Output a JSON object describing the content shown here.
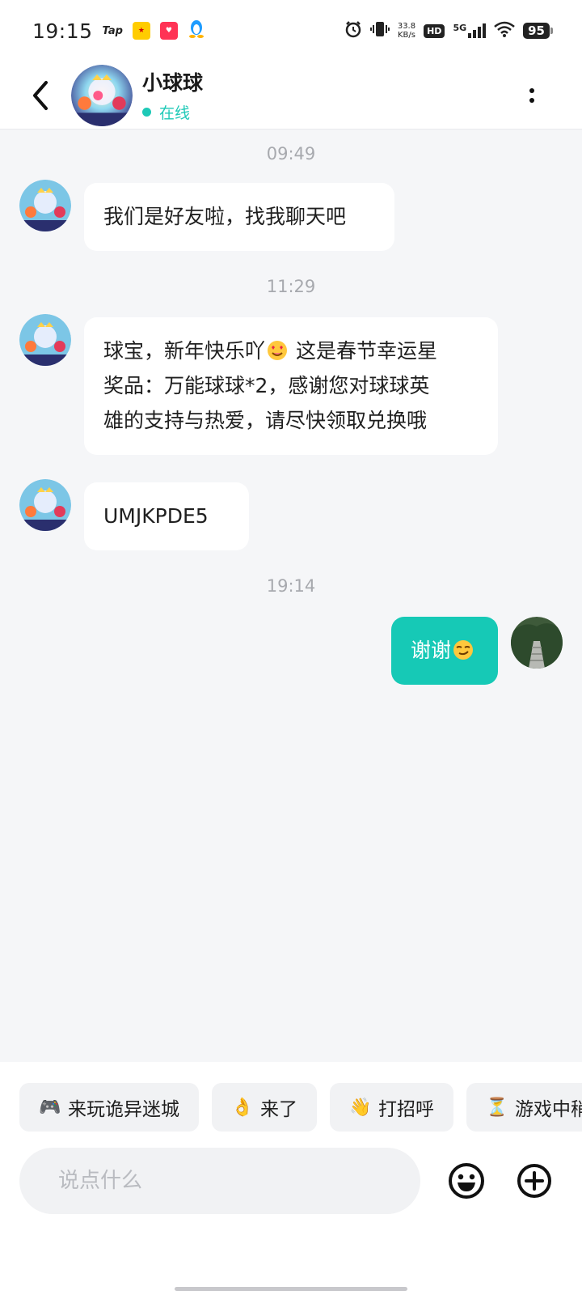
{
  "status_bar": {
    "time": "19:15",
    "tap_label": "Tap",
    "net_speed_value": "33.8",
    "net_speed_unit": "KB/s",
    "hd_label": "HD",
    "network_type": "5G",
    "battery": "95"
  },
  "header": {
    "contact_name": "小球球",
    "status": "在线"
  },
  "messages": [
    {
      "type": "time",
      "text": "09:49"
    },
    {
      "type": "received",
      "text": "我们是好友啦，找我聊天吧"
    },
    {
      "type": "time",
      "text": "11:29"
    },
    {
      "type": "received",
      "line1_before": "球宝，新年快乐吖",
      "line1_after": " 这是春节幸运星",
      "line2": "奖品：万能球球*2，感谢您对球球英",
      "line3": "雄的支持与热爱，请尽快领取兑换哦",
      "emoji": "heart-eyes-emoji"
    },
    {
      "type": "received",
      "text": "UMJKPDE5"
    },
    {
      "type": "time",
      "text": "19:14"
    },
    {
      "type": "sent",
      "text": "谢谢",
      "emoji": "smug-face-emoji"
    }
  ],
  "quick_replies": [
    {
      "icon": "🎮",
      "label": "来玩诡异迷城"
    },
    {
      "icon": "👌",
      "label": "来了"
    },
    {
      "icon": "👋",
      "label": "打招呼"
    },
    {
      "icon": "⏳",
      "label": "游戏中稍"
    }
  ],
  "composer": {
    "placeholder": "说点什么"
  },
  "colors": {
    "accent": "#16c9b6",
    "online": "#1ec9b7",
    "background": "#f5f6f8",
    "bubble_received": "#ffffff"
  }
}
